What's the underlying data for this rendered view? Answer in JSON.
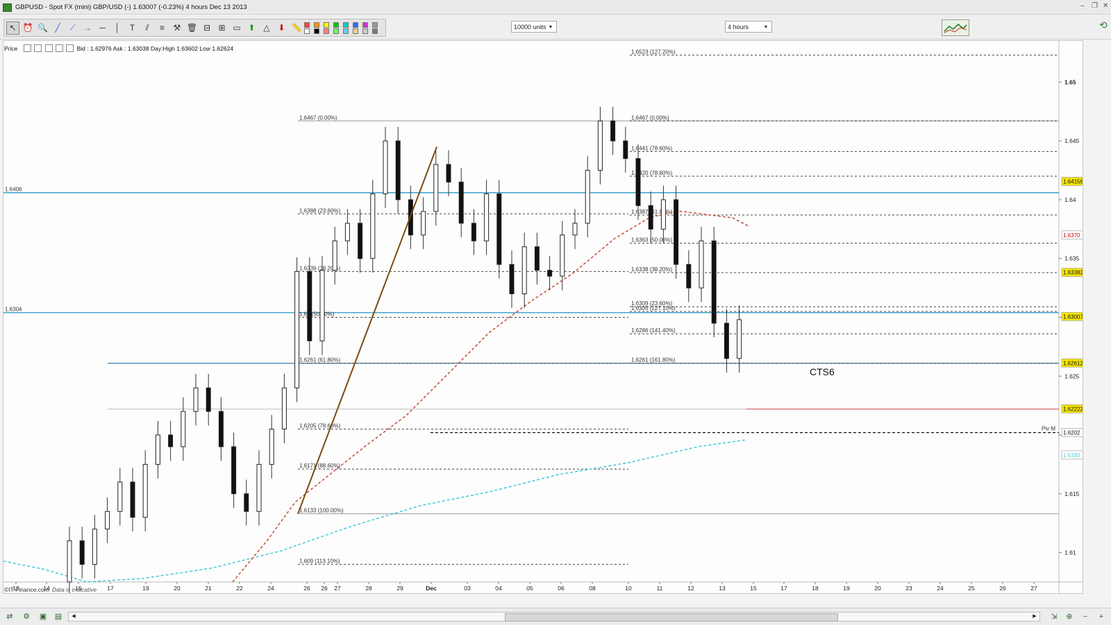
{
  "window": {
    "title": "GBPUSD - Spot FX (mini) GBP/USD (-)   1.63007 (-0.23%)   4 hours   Dec 13 2013",
    "controls": [
      "–",
      "❐",
      "✕"
    ]
  },
  "toolbar": {
    "tools": [
      "pointer-icon",
      "alarm-icon",
      "zoom-icon",
      "line-icon",
      "trend-line-icon",
      "ray-icon",
      "horizontal-line-icon",
      "vertical-line-icon",
      "text-icon",
      "channel-icon",
      "fibonacci-icon",
      "tools-icon",
      "delete-icon",
      "fib-retracement-icon",
      "fib-extension-icon",
      "rectangle-icon",
      "buy-arrow-icon",
      "triangle-icon",
      "sell-arrow-icon",
      "ruler-icon"
    ],
    "palette": [
      "#ff4040",
      "#ff9900",
      "#ffff00",
      "#00cc00",
      "#00cccc",
      "#3366ff",
      "#cc33cc",
      "#999999",
      "#ffffff",
      "#000000",
      "#ff8080",
      "#66ff66",
      "#66ccff",
      "#ffcc99",
      "#cccccc",
      "#777777"
    ],
    "units_label": "10000 units",
    "timeframe_label": "4 hours"
  },
  "infobar": {
    "price_label": "Price",
    "quote": "Bid : 1.62976  Ask : 1.63038  Day:High 1.63602  Low 1.62624"
  },
  "annotations": {
    "cts_label": "CTS6",
    "copyright": "©IT-Finance.com",
    "data_note": "Data is indicative"
  },
  "chart_data": {
    "type": "candlestick",
    "instrument": "GBPUSD",
    "timeframe": "4 hours",
    "ylim": [
      1.6075,
      1.6535
    ],
    "y_ticks": [
      1.61,
      1.615,
      1.62,
      1.625,
      1.63,
      1.635,
      1.64,
      1.645,
      1.65
    ],
    "y_tick_labels": [
      "1.61",
      "1.615",
      "1.62",
      "1.625",
      "1.63",
      "1.635",
      "1.64",
      "1.645",
      "1.65"
    ],
    "x_tick_labels": [
      "13",
      "14",
      "15",
      "17",
      "19",
      "20",
      "21",
      "22",
      "24",
      "26",
      "26",
      "27",
      "28",
      "29",
      "Dec",
      "03",
      "04",
      "05",
      "06",
      "08",
      "10",
      "11",
      "12",
      "13",
      "15",
      "17",
      "18",
      "19",
      "20",
      "23",
      "24",
      "25",
      "26",
      "27"
    ],
    "price_tags": [
      {
        "price": 1.64156,
        "label": "1.64156",
        "color": "#f4e400"
      },
      {
        "price": 1.637,
        "label": "1.6370",
        "color": "#ffffff",
        "text_color": "#c00000"
      },
      {
        "price": 1.63382,
        "label": "1.63382",
        "color": "#f4e400"
      },
      {
        "price": 1.63007,
        "label": "1.63007",
        "color": "#f4e400"
      },
      {
        "price": 1.62612,
        "label": "1.62612",
        "color": "#f4e400"
      },
      {
        "price": 1.62222,
        "label": "1.62222",
        "color": "#f4e400"
      },
      {
        "price": 1.6202,
        "label": "1.6202",
        "color": "#ffffff"
      },
      {
        "price": 1.6183,
        "label": "1.6183",
        "color": "#ffffff",
        "text_color": "#60c8d0"
      }
    ],
    "horizontal_levels": [
      {
        "price": 1.6406,
        "label": "1.6406",
        "color": "#3aa0c8"
      },
      {
        "price": 1.6304,
        "label": "1.6304",
        "color": "#3aa0c8"
      }
    ],
    "fib_left": [
      {
        "price": 1.6467,
        "label": "1.6467 (0.00%)"
      },
      {
        "price": 1.6388,
        "label": "1.6388 (23.60%)"
      },
      {
        "price": 1.6339,
        "label": "1.6339 (38.20%)"
      },
      {
        "price": 1.63,
        "label": "1.63 (50.00%)"
      },
      {
        "price": 1.6261,
        "label": "1.6261 (61.80%)"
      },
      {
        "price": 1.6205,
        "label": "1.6205 (78.60%)"
      },
      {
        "price": 1.6171,
        "label": "1.6171 (88.60%)"
      },
      {
        "price": 1.6133,
        "label": "1.6133 (100.00%)"
      },
      {
        "price": 1.609,
        "label": "1.609 (113.10%)"
      }
    ],
    "fib_right": [
      {
        "price": 1.6523,
        "label": "1.6523 (127.20%)"
      },
      {
        "price": 1.6467,
        "label": "1.6467 (0.00%)"
      },
      {
        "price": 1.6441,
        "label": "1.6441 (78.60%)"
      },
      {
        "price": 1.642,
        "label": "1.6420 (78.60%)"
      },
      {
        "price": 1.6387,
        "label": "1.6387 (61.80%)"
      },
      {
        "price": 1.6363,
        "label": "1.6363 (50.00%)"
      },
      {
        "price": 1.6338,
        "label": "1.6338 (38.20%)"
      },
      {
        "price": 1.6309,
        "label": "1.6309 (23.60%)"
      },
      {
        "price": 1.6305,
        "label": "1.6305 (127.10%)"
      },
      {
        "price": 1.6286,
        "label": "1.6286 (141.40%)"
      },
      {
        "price": 1.6261,
        "label": "1.6261 (161.80%)"
      }
    ],
    "pivot_label": "Piv M",
    "series": [
      {
        "name": "ma-short",
        "color": "#c84a3a",
        "style": "dashed"
      },
      {
        "name": "ma-long",
        "color": "#40c8d8",
        "style": "dashed"
      }
    ]
  }
}
